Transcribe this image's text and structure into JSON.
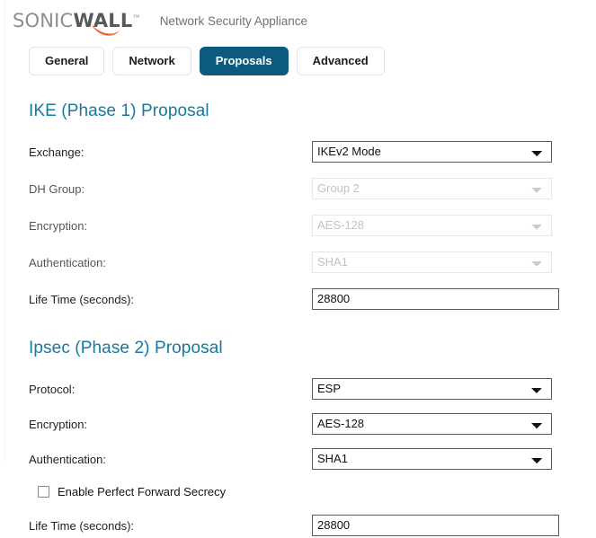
{
  "header": {
    "logo": {
      "part1": "SONIC",
      "part2": "WALL",
      "trademark": "™",
      "swoosh_color": "#f26524",
      "sonic_color": "#8d8d8d",
      "wall_color": "#57585a"
    },
    "product_title": "Network Security Appliance"
  },
  "tabs": {
    "items": [
      {
        "label": "General",
        "active": false
      },
      {
        "label": "Network",
        "active": false
      },
      {
        "label": "Proposals",
        "active": true
      },
      {
        "label": "Advanced",
        "active": false
      }
    ],
    "active_color": "#0c5a7d"
  },
  "phase1": {
    "title": "IKE (Phase 1) Proposal",
    "title_color": "#17789f",
    "fields": {
      "exchange": {
        "label": "Exchange:",
        "value": "IKEv2 Mode",
        "disabled": false,
        "options": [
          "IKEv2 Mode"
        ]
      },
      "dh_group": {
        "label": "DH Group:",
        "value": "Group 2",
        "disabled": true,
        "options": [
          "Group 2"
        ]
      },
      "encryption": {
        "label": "Encryption:",
        "value": "AES-128",
        "disabled": true,
        "options": [
          "AES-128"
        ]
      },
      "authentication": {
        "label": "Authentication:",
        "value": "SHA1",
        "disabled": true,
        "options": [
          "SHA1"
        ]
      },
      "life_time": {
        "label": "Life Time (seconds):",
        "value": "28800",
        "placeholder": ""
      }
    }
  },
  "phase2": {
    "title": "Ipsec (Phase 2) Proposal",
    "title_color": "#17789f",
    "fields": {
      "protocol": {
        "label": "Protocol:",
        "value": "ESP",
        "disabled": false,
        "options": [
          "ESP"
        ]
      },
      "encryption": {
        "label": "Encryption:",
        "value": "AES-128",
        "disabled": false,
        "options": [
          "AES-128"
        ]
      },
      "authentication": {
        "label": "Authentication:",
        "value": "SHA1",
        "disabled": false,
        "options": [
          "SHA1"
        ]
      },
      "pfs": {
        "label": "Enable Perfect Forward Secrecy",
        "checked": false
      },
      "life_time": {
        "label": "Life Time (seconds):",
        "value": "28800",
        "placeholder": ""
      }
    }
  }
}
